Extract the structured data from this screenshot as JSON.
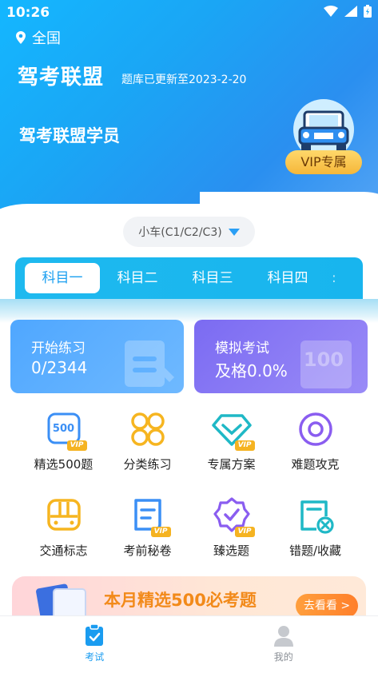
{
  "status_bar": {
    "time": "10:26"
  },
  "header": {
    "location": "全国",
    "app_title": "驾考联盟",
    "update_note": "题库已更新至2023-2-20",
    "member_title": "驾考联盟学员",
    "vip_label": "VIP专属"
  },
  "car_selector": {
    "value": "小车(C1/C2/C3)"
  },
  "subjects": {
    "tabs": [
      "科目一",
      "科目二",
      "科目三",
      "科目四"
    ],
    "active_index": 0,
    "overflow_glyph": ":"
  },
  "cards": {
    "practice": {
      "title": "开始练习",
      "value": "0/2344"
    },
    "exam": {
      "title": "模拟考试",
      "value": "及格0.0%",
      "deco_number": "100"
    }
  },
  "features": [
    {
      "label": "精选500题",
      "icon": "500-vip-icon",
      "icon_text": "500",
      "vip": "VIP"
    },
    {
      "label": "分类练习",
      "icon": "category-circles-icon"
    },
    {
      "label": "专属方案",
      "icon": "diamond-vip-icon",
      "vip": "VIP"
    },
    {
      "label": "难题攻克",
      "icon": "target-ring-icon"
    },
    {
      "label": "交通标志",
      "icon": "traffic-sign-icon"
    },
    {
      "label": "考前秘卷",
      "icon": "secret-paper-vip-icon",
      "vip": "VIP"
    },
    {
      "label": "臻选题",
      "icon": "badge-check-vip-icon",
      "vip": "VIP"
    },
    {
      "label": "错题/收藏",
      "icon": "wrong-question-icon"
    }
  ],
  "banner": {
    "text": "本月精选500必考题",
    "button": "去看看 >"
  },
  "bottom_nav": [
    {
      "label": "考试",
      "icon": "exam-clipboard-icon",
      "active": true
    },
    {
      "label": "我的",
      "icon": "profile-user-icon",
      "active": false
    }
  ],
  "colors": {
    "hero_blue": "#1aa6f5",
    "tab_blue": "#1eb9ef",
    "active_blue": "#1a9cf0",
    "vip_gold": "#f5b321",
    "exam_purple": "#7b6bf2",
    "practice_blue": "#4fa7ff",
    "banner_orange": "#f28a1a"
  }
}
